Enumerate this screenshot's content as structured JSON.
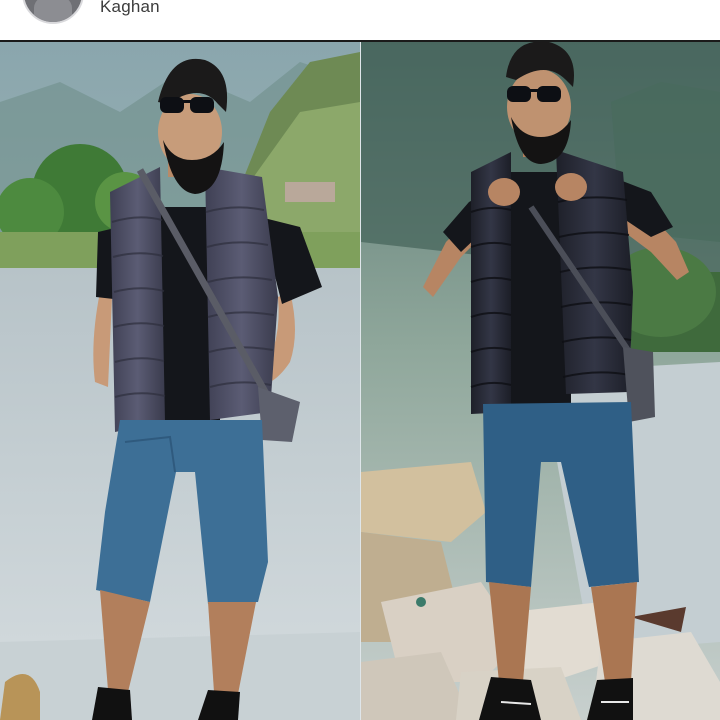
{
  "post": {
    "location": "Kaghan"
  },
  "photos": [
    {
      "subject": "man-in-puffer-vest-left"
    },
    {
      "subject": "man-in-puffer-vest-right"
    }
  ],
  "colors": {
    "vest": "#4a4a5e",
    "vest_dark": "#262935",
    "shorts": "#3d6f96",
    "shirt": "#14161b",
    "river": "#c9d3d8",
    "forest": "#4f7a4a"
  }
}
